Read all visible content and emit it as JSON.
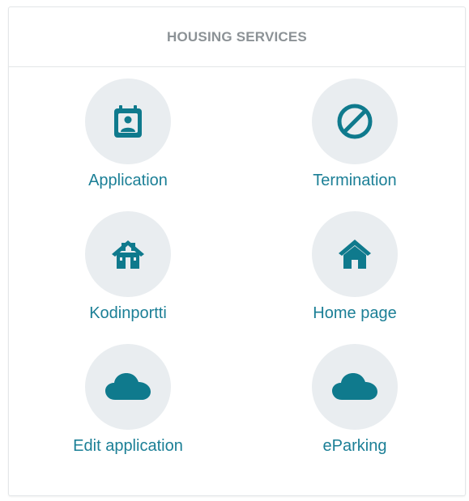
{
  "panel": {
    "title": "HOUSING SERVICES"
  },
  "colors": {
    "accent": "#1b7f96",
    "icon": "#0f7a8d",
    "circle_bg": "#e9edf0",
    "title_text": "#8c9296"
  },
  "services": [
    {
      "label": "Application",
      "icon": "calendar-user-icon"
    },
    {
      "label": "Termination",
      "icon": "ban-icon"
    },
    {
      "label": "Kodinportti",
      "icon": "house-door-icon"
    },
    {
      "label": "Home page",
      "icon": "home-icon"
    },
    {
      "label": "Edit application",
      "icon": "cloud-icon"
    },
    {
      "label": "eParking",
      "icon": "cloud-icon"
    }
  ]
}
